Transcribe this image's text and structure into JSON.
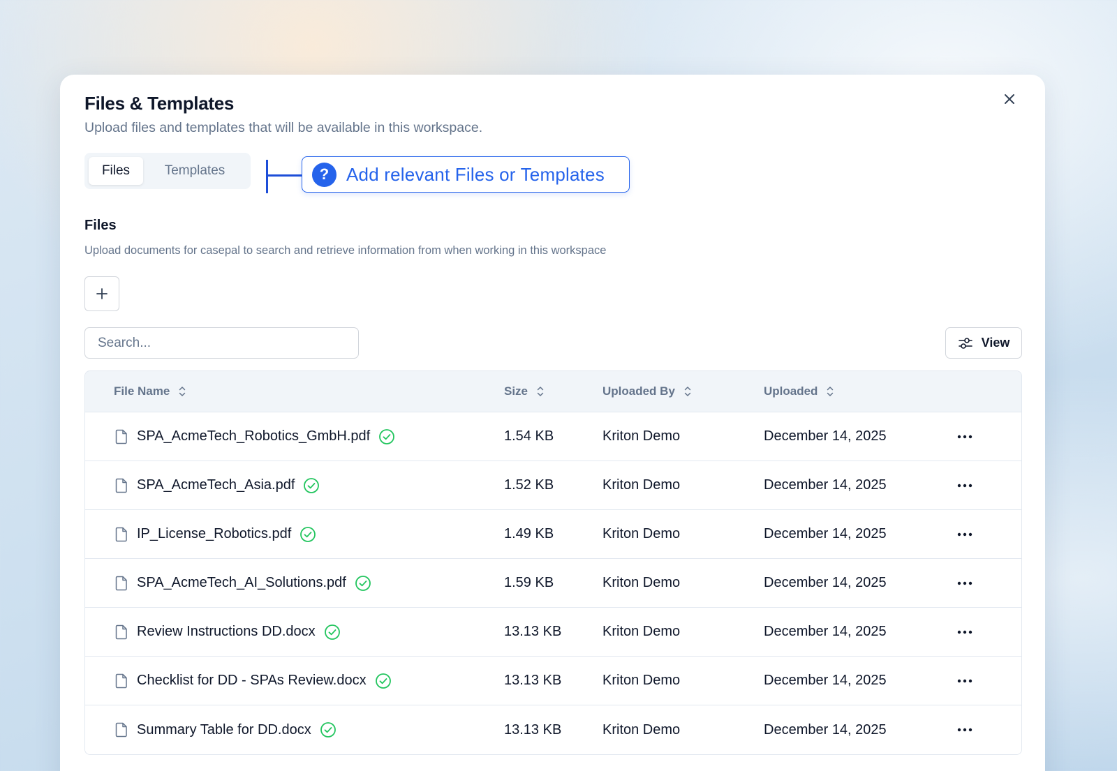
{
  "modal": {
    "title": "Files & Templates",
    "subtitle": "Upload files and templates that will be available in this workspace.",
    "close_icon": "close-icon"
  },
  "tabs": [
    {
      "label": "Files",
      "active": true
    },
    {
      "label": "Templates",
      "active": false
    }
  ],
  "callout": {
    "icon": "help-icon",
    "text": "Add relevant Files or Templates",
    "color": "#2563eb"
  },
  "files_section": {
    "title": "Files",
    "description": "Upload documents for casepal to search and retrieve information from when working in this workspace",
    "add_icon": "plus-icon"
  },
  "search": {
    "placeholder": "Search..."
  },
  "view_button": {
    "label": "View",
    "icon": "sliders-icon"
  },
  "table": {
    "columns": [
      {
        "label": "File Name",
        "icon": "sort-icon"
      },
      {
        "label": "Size",
        "icon": "sort-icon"
      },
      {
        "label": "Uploaded By",
        "icon": "sort-icon"
      },
      {
        "label": "Uploaded",
        "icon": "sort-icon"
      }
    ],
    "rows": [
      {
        "name": "SPA_AcmeTech_Robotics_GmbH.pdf",
        "size": "1.54 KB",
        "uploaded_by": "Kriton Demo",
        "uploaded": "December 14, 2025"
      },
      {
        "name": "SPA_AcmeTech_Asia.pdf",
        "size": "1.52 KB",
        "uploaded_by": "Kriton Demo",
        "uploaded": "December 14, 2025"
      },
      {
        "name": "IP_License_Robotics.pdf",
        "size": "1.49 KB",
        "uploaded_by": "Kriton Demo",
        "uploaded": "December 14, 2025"
      },
      {
        "name": "SPA_AcmeTech_AI_Solutions.pdf",
        "size": "1.59 KB",
        "uploaded_by": "Kriton Demo",
        "uploaded": "December 14, 2025"
      },
      {
        "name": "Review Instructions DD.docx",
        "size": "13.13 KB",
        "uploaded_by": "Kriton Demo",
        "uploaded": "December 14, 2025"
      },
      {
        "name": "Checklist for DD - SPAs Review.docx",
        "size": "13.13 KB",
        "uploaded_by": "Kriton Demo",
        "uploaded": "December 14, 2025"
      },
      {
        "name": "Summary Table for DD.docx",
        "size": "13.13 KB",
        "uploaded_by": "Kriton Demo",
        "uploaded": "December 14, 2025"
      }
    ],
    "row_icons": {
      "file": "file-icon",
      "status": "check-circle-icon",
      "menu": "more-horizontal-icon"
    },
    "status_color": "#22c55e"
  }
}
